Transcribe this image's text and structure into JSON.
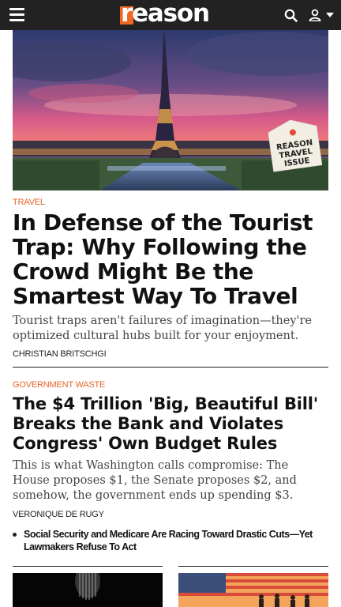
{
  "header": {
    "logo_text": "reason",
    "icons": [
      "menu-icon",
      "search-icon",
      "user-icon",
      "caret-down-icon"
    ],
    "colors": {
      "bar": "#222222",
      "brand_orange": "#f26722"
    }
  },
  "hero": {
    "image": "eiffel-tower-sunset-photo",
    "badge_text": "REASON TRAVEL ISSUE"
  },
  "article1": {
    "category": "TRAVEL",
    "headline": "In Defense of the Tourist Trap: Why Following the Crowd Might Be the Smartest Way To Travel",
    "dek": "Tourist traps aren't failures of imagination—they're optimized cultural hubs built for your enjoyment.",
    "byline": "CHRISTIAN BRITSCHGI"
  },
  "article2": {
    "category": "GOVERNMENT WASTE",
    "headline": "The $4 Trillion 'Big, Beautiful Bill' Breaks the Bank and Violates Congress' Own Budget Rules",
    "dek": "This is what Washington calls compromise: The House proposes $1, the Senate proposes $2, and somehow, the government ends up spending $3.",
    "byline": "VERONIQUE DE RUGY",
    "related": [
      "Social Security and Medicare Are Racing Toward Drastic Cuts—Yet Lawmakers Refuse To Act"
    ]
  },
  "cards": [
    {
      "image": "dark-spotlight-photo"
    },
    {
      "image": "american-flag-silhouettes-photo"
    }
  ],
  "accent_color": "#e8632a"
}
